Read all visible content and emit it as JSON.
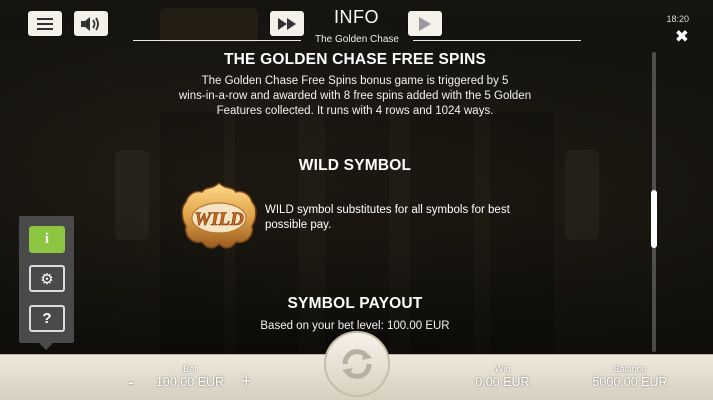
{
  "header": {
    "title": "INFO",
    "subtitle": "The Golden Chase",
    "clock": "18:20",
    "close_glyph": "✖"
  },
  "free_spins": {
    "heading": "THE GOLDEN CHASE FREE SPINS",
    "lines": [
      "The Golden Chase Free Spins bonus game is triggered by 5",
      "wins-in-a-row and awarded with 8 free spins added with the 5 Golden",
      "Features collected. It runs with 4 rows and 1024 ways."
    ]
  },
  "wild": {
    "heading": "WILD SYMBOL",
    "icon_text": "WILD",
    "lines": [
      "WILD symbol substitutes for all symbols for best",
      "possible pay."
    ]
  },
  "payout": {
    "heading": "SYMBOL PAYOUT",
    "text": "Based on your bet level: 100.00 EUR"
  },
  "side_panel": {
    "info_glyph": "i",
    "settings_glyph": "⚙",
    "help_glyph": "?"
  },
  "bottom_bar": {
    "bet_label": "Bet",
    "bet_value": "100.00 EUR",
    "minus": "-",
    "plus": "+",
    "win_label": "Win",
    "win_value": "0.00 EUR",
    "balance_label": "Balance",
    "balance_value": "5000.00 EUR"
  },
  "colors": {
    "accent_green": "#8cc53f",
    "wild_gold": "#e0a44a"
  }
}
